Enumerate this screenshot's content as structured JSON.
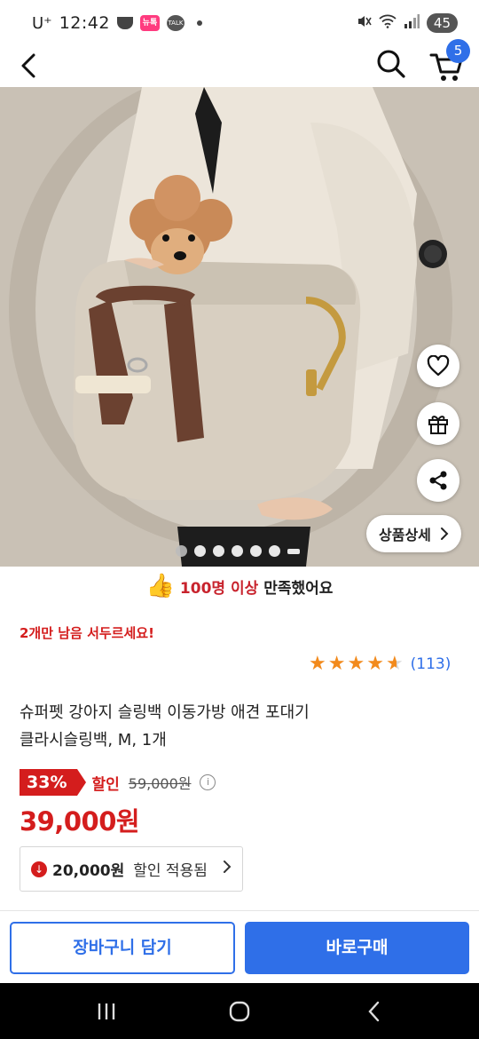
{
  "status_bar": {
    "carrier": "U⁺",
    "time": "12:42",
    "badge_text": "뉴톡",
    "talk_text": "TALK",
    "battery": "45"
  },
  "header": {
    "cart_count": "5"
  },
  "hero": {
    "detail_button_label": "상품상세",
    "image_count": 7,
    "active_index": 6
  },
  "satisfaction": {
    "highlight": "100명 이상",
    "rest": "만족했어요"
  },
  "stock_warning": "2개만 남음 서두르세요!",
  "rating": {
    "stars": 4.5,
    "review_count": "(113)"
  },
  "product": {
    "title_line1": "슈퍼펫 강아지 슬링백 이동가방 애견 포대기",
    "title_line2": "클라시슬링백, M, 1개"
  },
  "price": {
    "discount_percent": "33%",
    "discount_label": "할인",
    "original": "59,000원",
    "sale": "39,000원"
  },
  "coupon": {
    "amount": "20,000원",
    "label": "할인 적용됨"
  },
  "actions": {
    "add_to_cart": "장바구니 담기",
    "buy_now": "바로구매"
  },
  "colors": {
    "accent_blue": "#2f6fe8",
    "sale_red": "#d41d1d",
    "star_orange": "#f28a1c"
  }
}
